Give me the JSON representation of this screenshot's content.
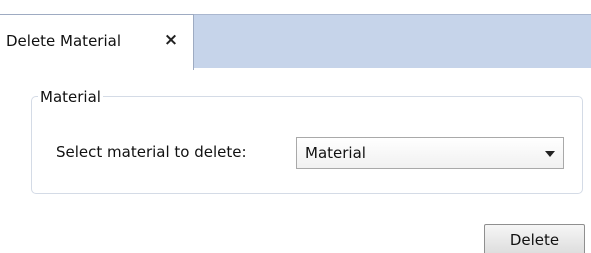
{
  "tab": {
    "title": "Delete Material",
    "close_icon": "close-icon",
    "close_glyph": "×"
  },
  "group": {
    "legend": "Material"
  },
  "form": {
    "label": "Select material to delete:",
    "select": {
      "value": "Material",
      "arrow_icon": "chevron-down-icon"
    }
  },
  "actions": {
    "delete_label": "Delete"
  },
  "colors": {
    "tabbar": "#c6d4ea",
    "border": "#d4dbe6"
  }
}
